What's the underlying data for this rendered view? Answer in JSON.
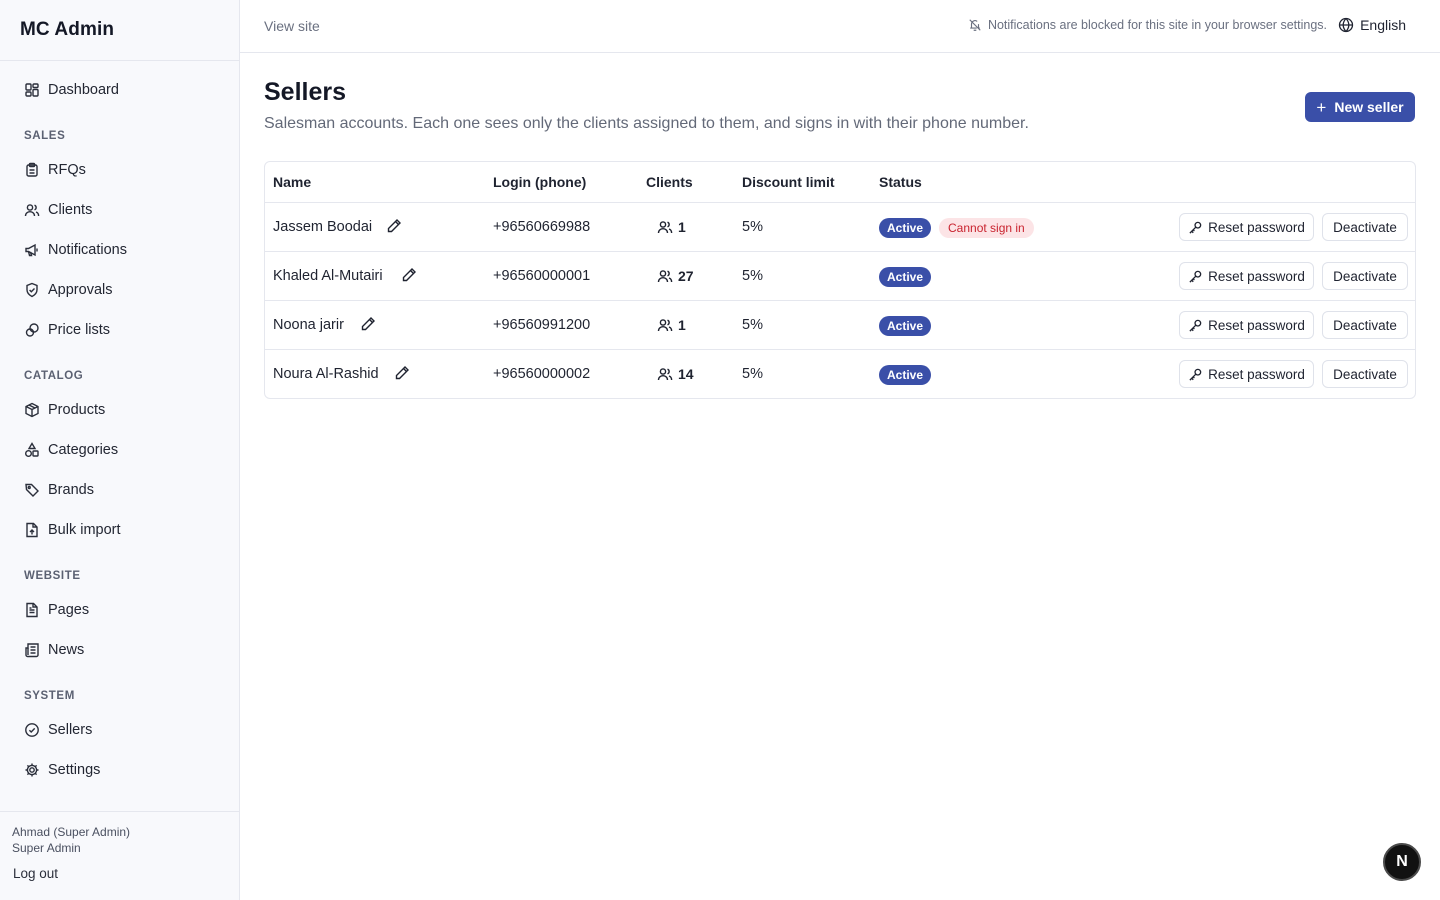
{
  "sidebar": {
    "brand": "MC Admin",
    "dashboard": {
      "label": "Dashboard",
      "icon": "dashboard-icon"
    },
    "sections": {
      "sales": "SALES",
      "catalog": "CATALOG",
      "website": "WEBSITE",
      "system": "SYSTEM"
    },
    "items": {
      "rfqs": {
        "label": "RFQs",
        "icon": "clipboard-icon"
      },
      "clients": {
        "label": "Clients",
        "icon": "users-icon"
      },
      "notifications": {
        "label": "Notifications",
        "icon": "megaphone-icon"
      },
      "approvals": {
        "label": "Approvals",
        "icon": "shield-check-icon"
      },
      "price_lists": {
        "label": "Price lists",
        "icon": "coins-icon"
      },
      "products": {
        "label": "Products",
        "icon": "package-icon"
      },
      "categories": {
        "label": "Categories",
        "icon": "shapes-icon"
      },
      "brands": {
        "label": "Brands",
        "icon": "tag-icon"
      },
      "bulk_import": {
        "label": "Bulk import",
        "icon": "file-upload-icon"
      },
      "pages": {
        "label": "Pages",
        "icon": "file-text-icon"
      },
      "news": {
        "label": "News",
        "icon": "newspaper-icon"
      },
      "sellers": {
        "label": "Sellers",
        "icon": "badge-check-icon"
      },
      "settings": {
        "label": "Settings",
        "icon": "gear-icon"
      }
    },
    "user": {
      "name": "Ahmad (Super Admin)",
      "role": "Super Admin",
      "logout": "Log out"
    }
  },
  "topbar": {
    "view_site": "View site",
    "notification_notice": "Notifications are blocked for this site in your browser settings.",
    "language": "English"
  },
  "page": {
    "title": "Sellers",
    "description": "Salesman accounts. Each one sees only the clients assigned to them, and signs in with their phone number.",
    "new_button": "New seller"
  },
  "table": {
    "headers": {
      "name": "Name",
      "login": "Login (phone)",
      "clients": "Clients",
      "discount": "Discount limit",
      "status": "Status"
    },
    "rows": [
      {
        "name": "Jassem Boodai",
        "login": "+96560669988",
        "clients": "1",
        "discount": "5%",
        "status": "Active",
        "warning": "Cannot sign in",
        "reset": "Reset password",
        "deactivate": "Deactivate"
      },
      {
        "name": "Khaled Al-Mutairi",
        "login": "+96560000001",
        "clients": "27",
        "discount": "5%",
        "status": "Active",
        "reset": "Reset password",
        "deactivate": "Deactivate"
      },
      {
        "name": "Noona jarir",
        "login": "+96560991200",
        "clients": "1",
        "discount": "5%",
        "status": "Active",
        "reset": "Reset password",
        "deactivate": "Deactivate"
      },
      {
        "name": "Noura Al-Rashid",
        "login": "+96560000002",
        "clients": "14",
        "discount": "5%",
        "status": "Active",
        "reset": "Reset password",
        "deactivate": "Deactivate"
      }
    ]
  },
  "fab": {
    "label": "N"
  },
  "colors": {
    "accent": "#3a4fa8",
    "danger_text": "#c9232f",
    "danger_bg": "#fce4e6",
    "sidebar_bg": "#f8f9fc",
    "border": "#e5e7ee"
  }
}
